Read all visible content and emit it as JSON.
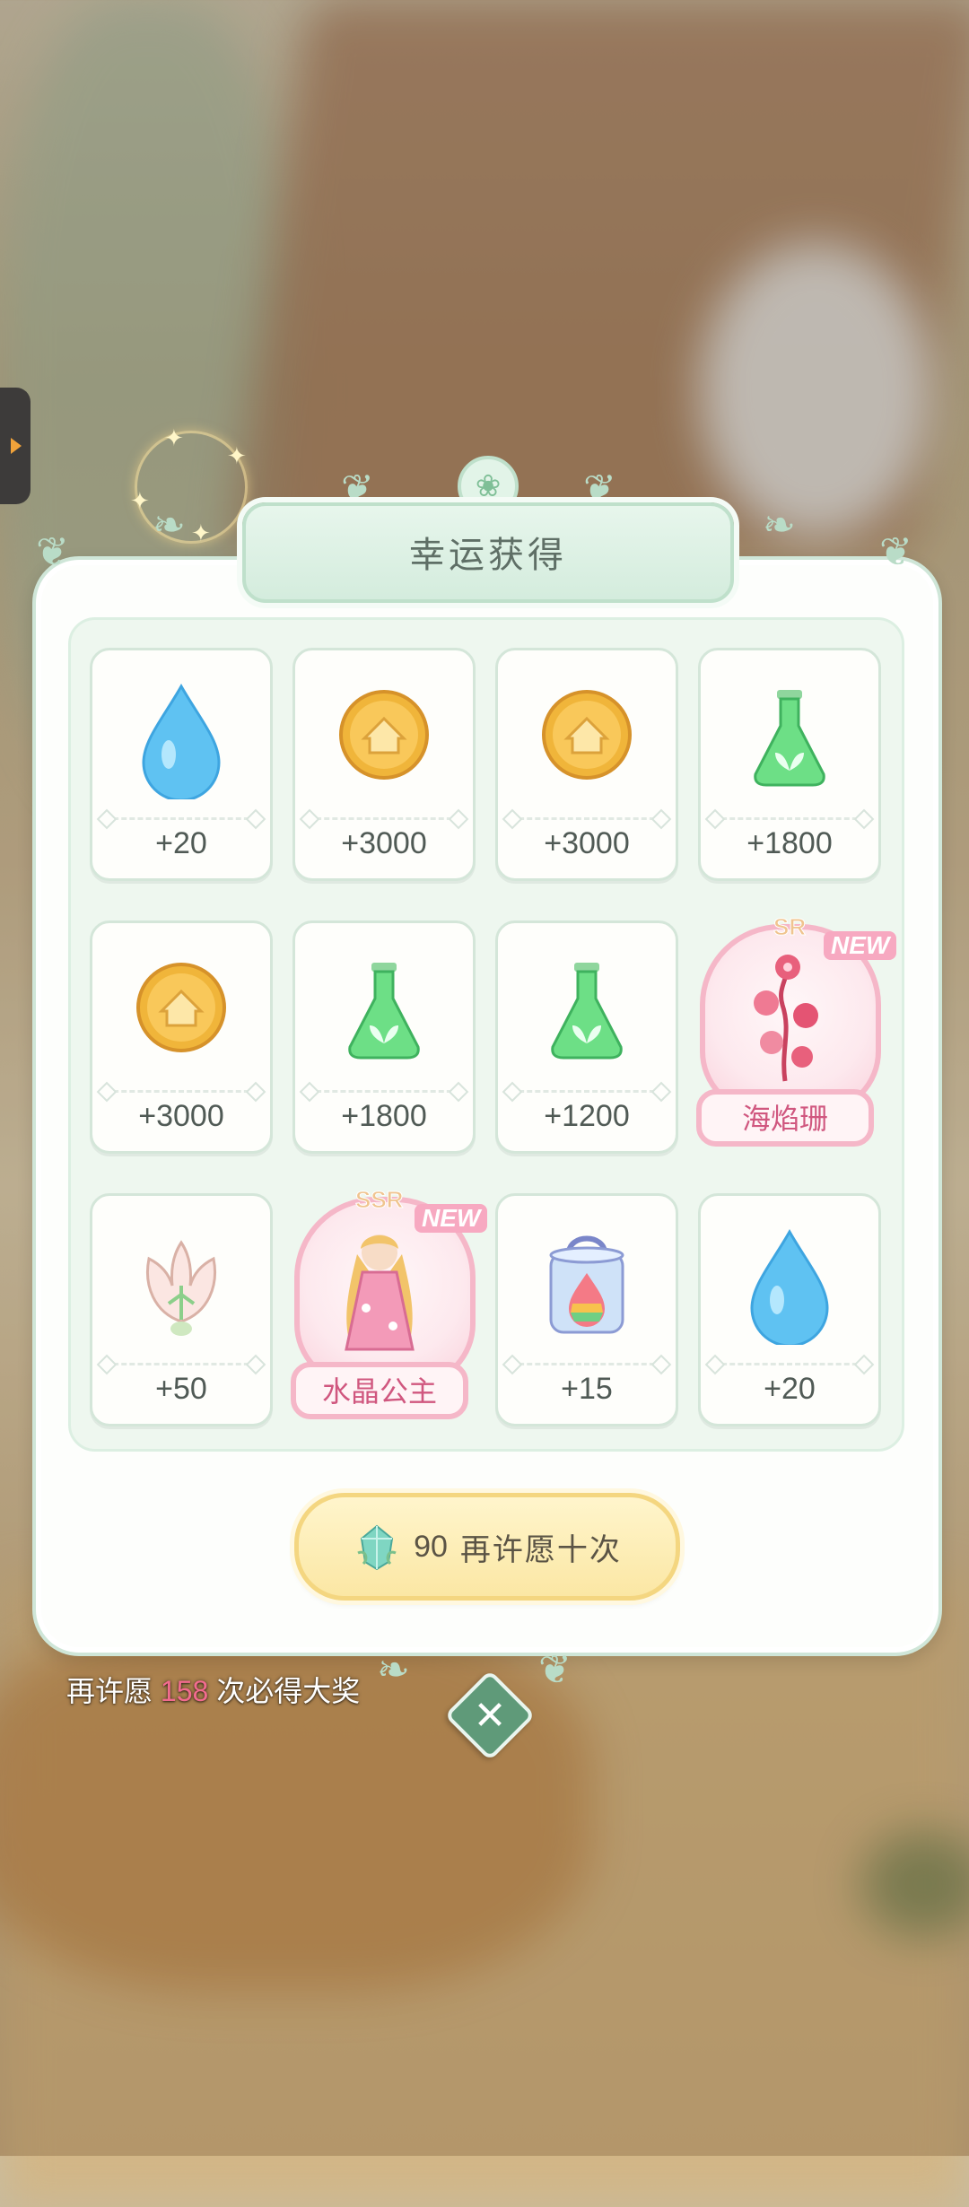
{
  "title": "幸运获得",
  "rewards": [
    {
      "icon": "water-drop-icon",
      "amount": "+20"
    },
    {
      "icon": "gold-coin-icon",
      "amount": "+3000"
    },
    {
      "icon": "gold-coin-icon",
      "amount": "+3000"
    },
    {
      "icon": "green-flask-icon",
      "amount": "+1800"
    },
    {
      "icon": "gold-coin-icon",
      "amount": "+3000"
    },
    {
      "icon": "green-flask-icon",
      "amount": "+1800"
    },
    {
      "icon": "green-flask-icon",
      "amount": "+1200"
    },
    {
      "icon": "coral-flower-icon",
      "rarity": "SR",
      "badge": "NEW",
      "name": "海焰珊"
    },
    {
      "icon": "lotus-lamp-icon",
      "amount": "+50"
    },
    {
      "icon": "crystal-princess-icon",
      "rarity": "SSR",
      "badge": "NEW",
      "name": "水晶公主"
    },
    {
      "icon": "rainbow-jar-icon",
      "amount": "+15"
    },
    {
      "icon": "water-drop-icon",
      "amount": "+20"
    }
  ],
  "wish_button": {
    "cost": "90",
    "label": "再许愿十次",
    "icon": "gem-icon"
  },
  "hint": {
    "prefix": "再许愿",
    "count": "158",
    "suffix": "次必得大奖"
  },
  "close": {
    "icon": "close-icon",
    "symbol": "✕"
  },
  "colors": {
    "accent": "#cfe6d8",
    "rare_pink": "#f5b7c8",
    "highlight": "#f26b8f",
    "button_gold": "#f4d680"
  }
}
